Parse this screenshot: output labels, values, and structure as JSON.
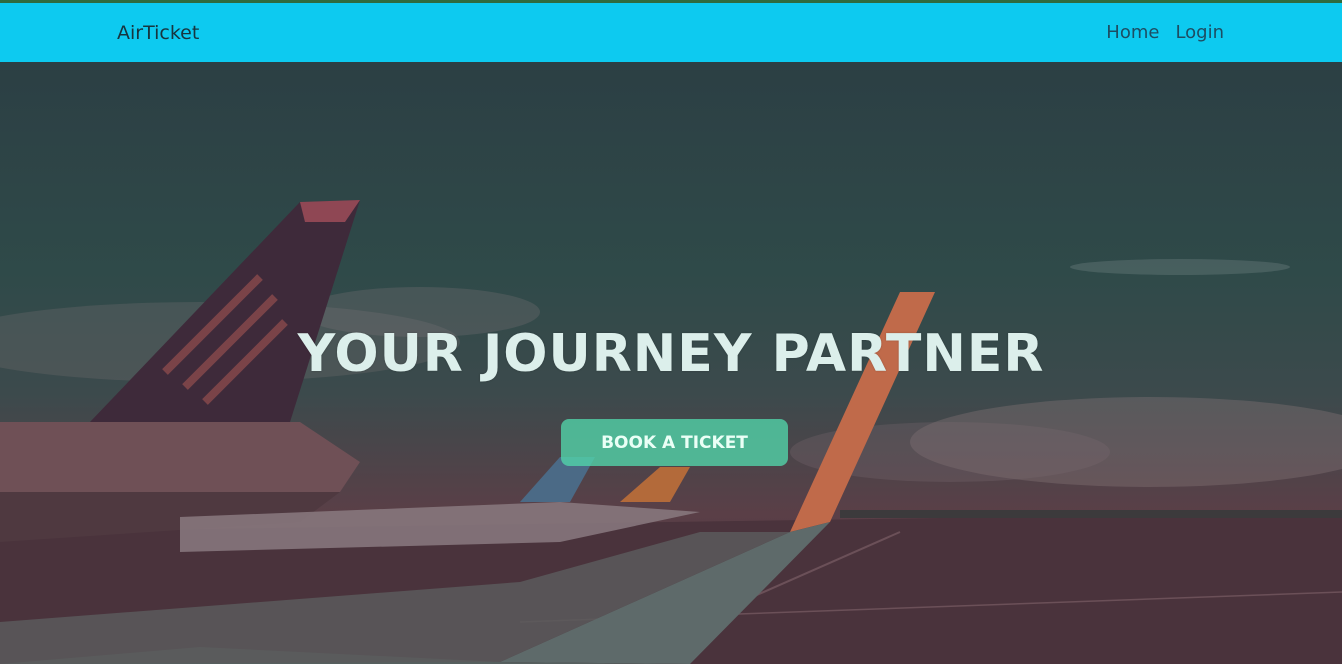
{
  "navbar": {
    "brand": "AirTicket",
    "links": [
      {
        "label": "Home"
      },
      {
        "label": "Login"
      }
    ]
  },
  "hero": {
    "title": "YOUR JOURNEY PARTNER",
    "cta_label": "BOOK A TICKET"
  },
  "colors": {
    "navbar_bg": "#0dcaf0",
    "cta_bg": "#52d6aa",
    "hero_overlay": "#2f4a49"
  }
}
